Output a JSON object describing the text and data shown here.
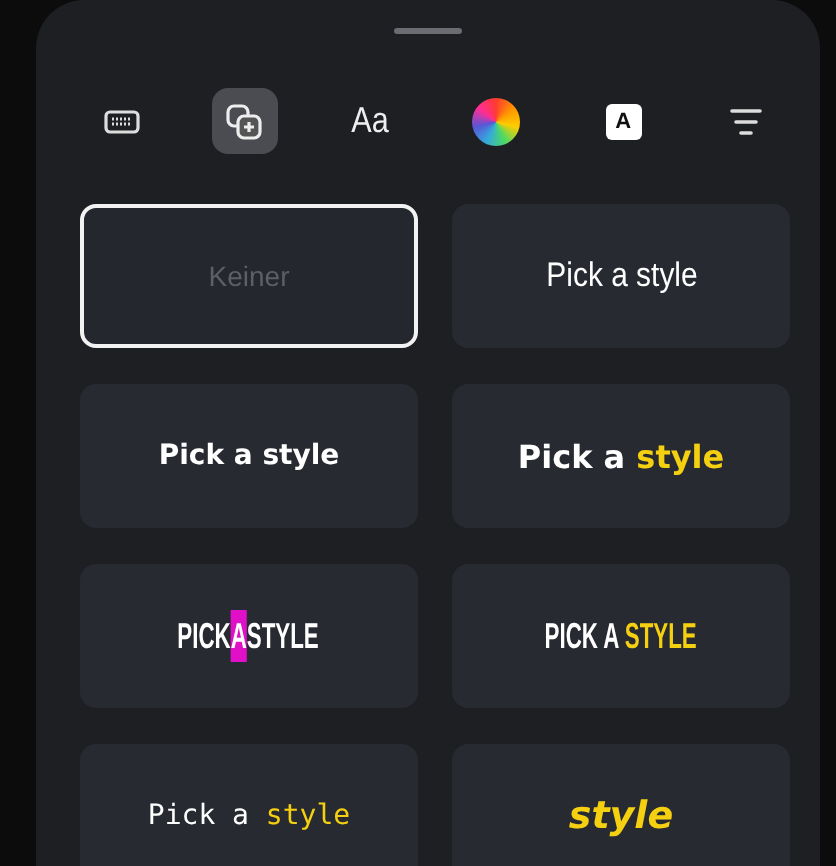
{
  "toolbar": [
    {
      "kind": "keyboard",
      "selected": false
    },
    {
      "kind": "sticker",
      "selected": true
    },
    {
      "kind": "font",
      "label": "Aa",
      "selected": false
    },
    {
      "kind": "color",
      "selected": false
    },
    {
      "kind": "background",
      "label": "A",
      "selected": false
    },
    {
      "kind": "align",
      "selected": false
    }
  ],
  "styles": [
    {
      "kind": "none",
      "selected": true,
      "parts": [
        {
          "text": "Keiner",
          "color": "#5c5f68"
        }
      ]
    },
    {
      "kind": "regular",
      "selected": false,
      "parts": [
        {
          "text": "Pick a style",
          "color": "#ffffff"
        }
      ]
    },
    {
      "kind": "bold",
      "selected": false,
      "parts": [
        {
          "text": "Pick a style",
          "color": "#ffffff"
        }
      ]
    },
    {
      "kind": "bold",
      "selected": false,
      "parts": [
        {
          "text": "Pick a ",
          "color": "#ffffff"
        },
        {
          "text": "style",
          "color": "#f5d010"
        }
      ]
    },
    {
      "kind": "condensed",
      "selected": false,
      "parts": [
        {
          "text": "PICK",
          "color": "#ffffff"
        },
        {
          "text": "A",
          "highlighted": true
        },
        {
          "text": "STYLE",
          "color": "#ffffff"
        }
      ]
    },
    {
      "kind": "condensed",
      "selected": false,
      "parts": [
        {
          "text": "PICK A ",
          "color": "#ffffff"
        },
        {
          "text": "STYLE",
          "color": "#f5d010"
        }
      ]
    },
    {
      "kind": "mono",
      "selected": false,
      "parts": [
        {
          "text": "Pick a ",
          "color": "#ffffff"
        },
        {
          "text": "style",
          "color": "#f5d010"
        }
      ]
    },
    {
      "kind": "italic",
      "selected": false,
      "parts": [
        {
          "text": "style",
          "color": "#f5d010"
        }
      ]
    }
  ]
}
